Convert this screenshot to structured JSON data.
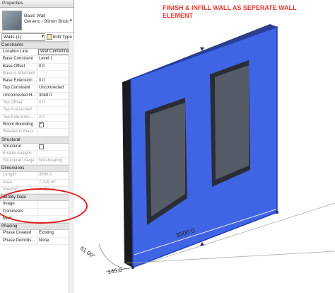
{
  "palette": {
    "title": "Properties",
    "type": {
      "family": "Basic Wall",
      "name": "Generic - 90mm Brick"
    },
    "selector": {
      "value": "Walls (1)",
      "edit_type": "Edit Type"
    },
    "sections": [
      {
        "label": "Constraints",
        "rows": [
          {
            "k": "Location Line",
            "v": "Wall Centerline",
            "boxed": true
          },
          {
            "k": "Base Constraint",
            "v": "Level 1"
          },
          {
            "k": "Base Offset",
            "v": "0.0"
          },
          {
            "k": "Base is Attached",
            "v": "",
            "dim": true
          },
          {
            "k": "Base Extension ...",
            "v": "0.0"
          },
          {
            "k": "Top Constraint",
            "v": "Unconnected"
          },
          {
            "k": "Unconnected H...",
            "v": "3048.0"
          },
          {
            "k": "Top Offset",
            "v": "0.0",
            "dim": true
          },
          {
            "k": "Top is Attached",
            "v": "",
            "dim": true
          },
          {
            "k": "Top Extension ...",
            "v": "0.0",
            "dim": true
          },
          {
            "k": "Room Bounding",
            "check": true,
            "checked": true
          },
          {
            "k": "Related to Mass",
            "v": "",
            "dim": true
          }
        ]
      },
      {
        "label": "Structural",
        "rows": [
          {
            "k": "Structural",
            "check": true,
            "checked": false
          },
          {
            "k": "Enable Analytic...",
            "v": "",
            "dim": true
          },
          {
            "k": "Structural Usage",
            "v": "Non-bearing",
            "dim": true
          }
        ]
      },
      {
        "label": "Dimensions",
        "rows": [
          {
            "k": "Length",
            "v": "3500.0",
            "dim": true
          },
          {
            "k": "Area",
            "v": "7.319 m²",
            "dim": true
          },
          {
            "k": "Volume",
            "v": "0.659 m³",
            "dim": true
          }
        ]
      },
      {
        "label": "Identity Data",
        "rows": [
          {
            "k": "Image",
            "v": ""
          },
          {
            "k": "Comments",
            "v": ""
          },
          {
            "k": "Mark",
            "v": ""
          }
        ]
      },
      {
        "label": "Phasing",
        "rows": [
          {
            "k": "Phase Created",
            "v": "Existing"
          },
          {
            "k": "Phase Demolis...",
            "v": "None"
          }
        ]
      }
    ]
  },
  "view": {
    "note": "FINISH & INFILL WALL AS SEPERATE WALL ELEMENT",
    "dim_length": "3500.0",
    "dim_angle": "61.00°",
    "dim_thickness": "145.0"
  },
  "colors": {
    "wall_face": "#3f67e8",
    "wall_dark": "#1e2a6a",
    "annotation_red": "#e53a2e"
  }
}
